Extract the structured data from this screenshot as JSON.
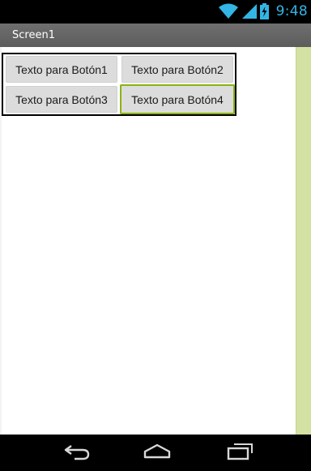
{
  "status_bar": {
    "time": "9:48",
    "icons": [
      "wifi-icon",
      "signal-icon",
      "battery-charging-icon"
    ],
    "accent_color": "#33b5e5"
  },
  "app": {
    "title": "Screen1"
  },
  "table": {
    "buttons": [
      {
        "label": "Texto para Botón1"
      },
      {
        "label": "Texto para Botón2"
      },
      {
        "label": "Texto para Botón3"
      },
      {
        "label": "Texto para Botón4",
        "focused": true
      }
    ],
    "focus_color": "#8ab30f"
  },
  "navigation": {
    "icons": [
      "back-icon",
      "home-icon",
      "recent-apps-icon"
    ]
  }
}
